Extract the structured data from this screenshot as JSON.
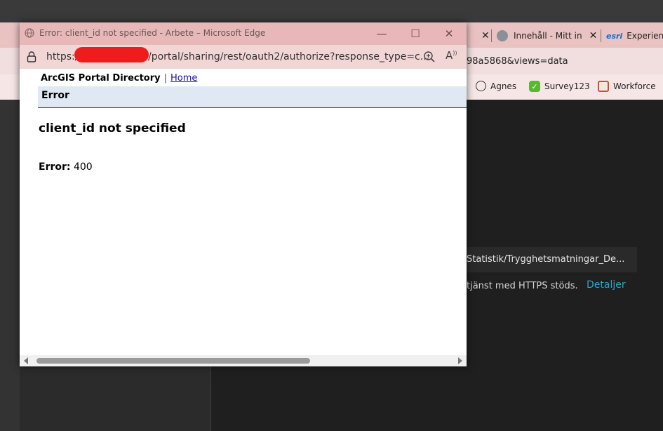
{
  "background_window": {
    "title_text": "Arbete – Microsoft Edge",
    "tabs": [
      {
        "label": "",
        "icon": "close-icon"
      },
      {
        "label": "Innehåll - Mitt in",
        "icon": "globe-icon"
      },
      {
        "label": "Experienc",
        "logo": "esri"
      }
    ],
    "address_fragment": "98a5868&views=data",
    "favorites": [
      {
        "label": "Agnes",
        "icon": "globe-icon"
      },
      {
        "label": "Survey123",
        "icon": "survey123-icon"
      },
      {
        "label": "Workforce",
        "icon": "workforce-icon"
      }
    ],
    "path_text": "Statistik/Trygghetsmatningar_De...",
    "https_text": "tjänst med HTTPS stöds.",
    "details_link": "Detaljer"
  },
  "popup": {
    "title": "Error: client_id not specified - Arbete – Microsoft Edge",
    "address_prefix": "https:/",
    "address_rest": "/portal/sharing/rest/oauth2/authorize?response_type=c...",
    "page": {
      "portal_title": "ArcGIS Portal Directory",
      "separator": "|",
      "home_link": "Home",
      "error_bar_label": "Error",
      "error_heading": "client_id not specified",
      "error_code_label": "Error:",
      "error_code_value": "400"
    }
  },
  "colors": {
    "popup_titlebar": "#e8b7b7",
    "redaction": "#ee1c1c",
    "error_bar": "#dfe8f3",
    "link": "#1a0dab",
    "details_link": "#31a3c8"
  }
}
